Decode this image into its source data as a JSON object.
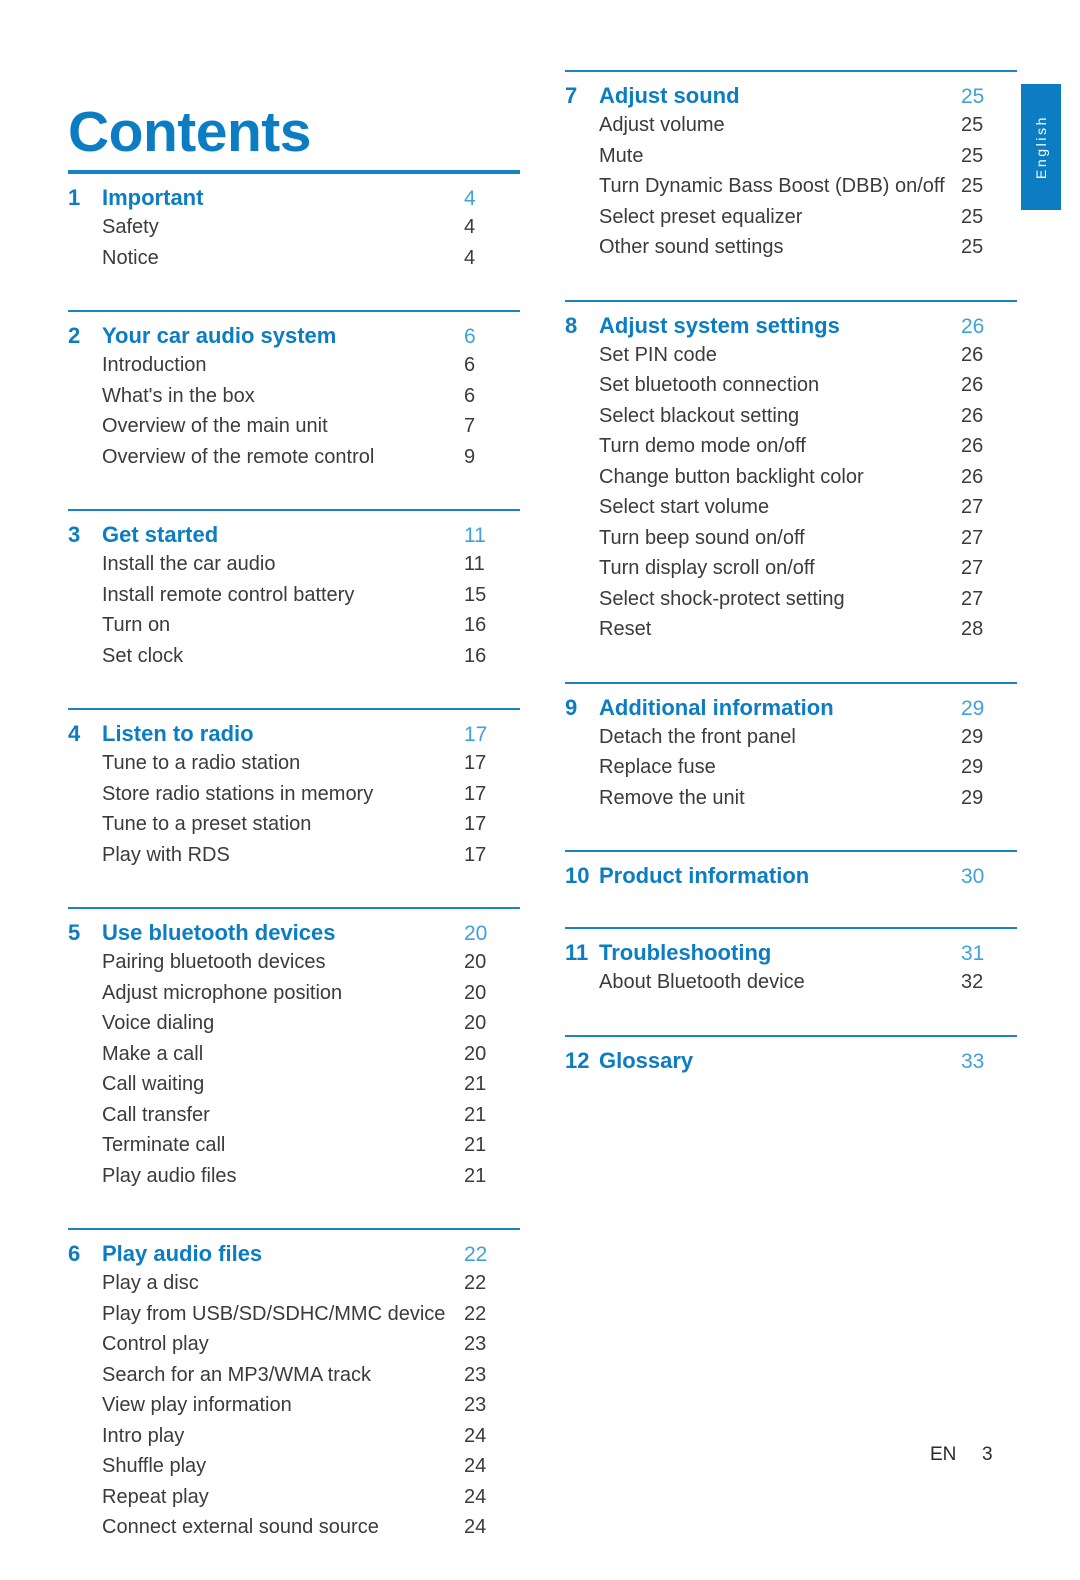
{
  "page_title": "Contents",
  "side_tab": {
    "label": "English"
  },
  "footer": {
    "language_code": "EN",
    "page_number": "3"
  },
  "colors": {
    "accent_blue": "#0C7DC2",
    "rule_blue": "#1684C6",
    "page_number_blue": "#3FA2D8",
    "body_text": "#3B3B3B"
  },
  "columns": [
    {
      "id": "left",
      "sections": [
        {
          "number": "1",
          "title": "Important",
          "page": "4",
          "rule": "thick",
          "items": [
            {
              "label": "Safety",
              "page": "4"
            },
            {
              "label": "Notice",
              "page": "4"
            }
          ]
        },
        {
          "number": "2",
          "title": "Your car audio system",
          "page": "6",
          "rule": "thin",
          "items": [
            {
              "label": "Introduction",
              "page": "6"
            },
            {
              "label": "What's in the box",
              "page": "6"
            },
            {
              "label": "Overview of the main unit",
              "page": "7"
            },
            {
              "label": "Overview of the remote control",
              "page": "9"
            }
          ]
        },
        {
          "number": "3",
          "title": "Get started",
          "page": "11",
          "rule": "thin",
          "items": [
            {
              "label": "Install the car audio",
              "page": "11"
            },
            {
              "label": "Install remote control battery",
              "page": "15"
            },
            {
              "label": "Turn on",
              "page": "16"
            },
            {
              "label": "Set clock",
              "page": "16"
            }
          ]
        },
        {
          "number": "4",
          "title": "Listen to radio",
          "page": "17",
          "rule": "thin",
          "items": [
            {
              "label": "Tune to a radio station",
              "page": "17"
            },
            {
              "label": "Store radio stations in memory",
              "page": "17"
            },
            {
              "label": "Tune to a preset station",
              "page": "17"
            },
            {
              "label": "Play with RDS",
              "page": "17"
            }
          ]
        },
        {
          "number": "5",
          "title": "Use bluetooth devices",
          "page": "20",
          "rule": "thin",
          "items": [
            {
              "label": "Pairing bluetooth devices",
              "page": "20"
            },
            {
              "label": "Adjust microphone position",
              "page": "20"
            },
            {
              "label": "Voice dialing",
              "page": "20"
            },
            {
              "label": "Make a call",
              "page": "20"
            },
            {
              "label": "Call waiting",
              "page": "21"
            },
            {
              "label": "Call transfer",
              "page": "21"
            },
            {
              "label": "Terminate call",
              "page": "21"
            },
            {
              "label": "Play audio files",
              "page": "21"
            }
          ]
        },
        {
          "number": "6",
          "title": "Play audio files",
          "page": "22",
          "rule": "thin",
          "items": [
            {
              "label": "Play a disc",
              "page": "22"
            },
            {
              "label": "Play from USB/SD/SDHC/MMC device",
              "page": "22"
            },
            {
              "label": "Control play",
              "page": "23"
            },
            {
              "label": "Search for an MP3/WMA track",
              "page": "23"
            },
            {
              "label": "View play information",
              "page": "23"
            },
            {
              "label": "Intro play",
              "page": "24"
            },
            {
              "label": "Shuffle play",
              "page": "24"
            },
            {
              "label": "Repeat play",
              "page": "24"
            },
            {
              "label": "Connect external sound source",
              "page": "24"
            }
          ]
        }
      ]
    },
    {
      "id": "right",
      "sections": [
        {
          "number": "7",
          "title": "Adjust sound",
          "page": "25",
          "rule": "thin",
          "items": [
            {
              "label": "Adjust volume",
              "page": "25"
            },
            {
              "label": "Mute",
              "page": "25"
            },
            {
              "label": "Turn Dynamic Bass Boost (DBB) on/off",
              "page": "25"
            },
            {
              "label": "Select preset equalizer",
              "page": "25"
            },
            {
              "label": "Other sound settings",
              "page": "25"
            }
          ]
        },
        {
          "number": "8",
          "title": "Adjust system settings",
          "page": "26",
          "rule": "thin",
          "items": [
            {
              "label": "Set PIN code",
              "page": "26"
            },
            {
              "label": "Set bluetooth connection",
              "page": "26"
            },
            {
              "label": "Select blackout setting",
              "page": "26"
            },
            {
              "label": "Turn demo mode on/off",
              "page": "26"
            },
            {
              "label": "Change button backlight color",
              "page": "26"
            },
            {
              "label": "Select start volume",
              "page": "27"
            },
            {
              "label": "Turn beep sound on/off",
              "page": "27"
            },
            {
              "label": "Turn display scroll on/off",
              "page": "27"
            },
            {
              "label": "Select shock-protect setting",
              "page": "27"
            },
            {
              "label": "Reset",
              "page": "28"
            }
          ]
        },
        {
          "number": "9",
          "title": "Additional information",
          "page": "29",
          "rule": "thin",
          "items": [
            {
              "label": "Detach the front panel",
              "page": "29"
            },
            {
              "label": "Replace fuse",
              "page": "29"
            },
            {
              "label": "Remove the unit",
              "page": "29"
            }
          ]
        },
        {
          "number": "10",
          "title": "Product information",
          "page": "30",
          "rule": "thin",
          "items": []
        },
        {
          "number": "11",
          "title": "Troubleshooting",
          "page": "31",
          "rule": "thin",
          "items": [
            {
              "label": "About Bluetooth device",
              "page": "32"
            }
          ]
        },
        {
          "number": "12",
          "title": "Glossary",
          "page": "33",
          "rule": "thin",
          "items": []
        }
      ]
    }
  ]
}
